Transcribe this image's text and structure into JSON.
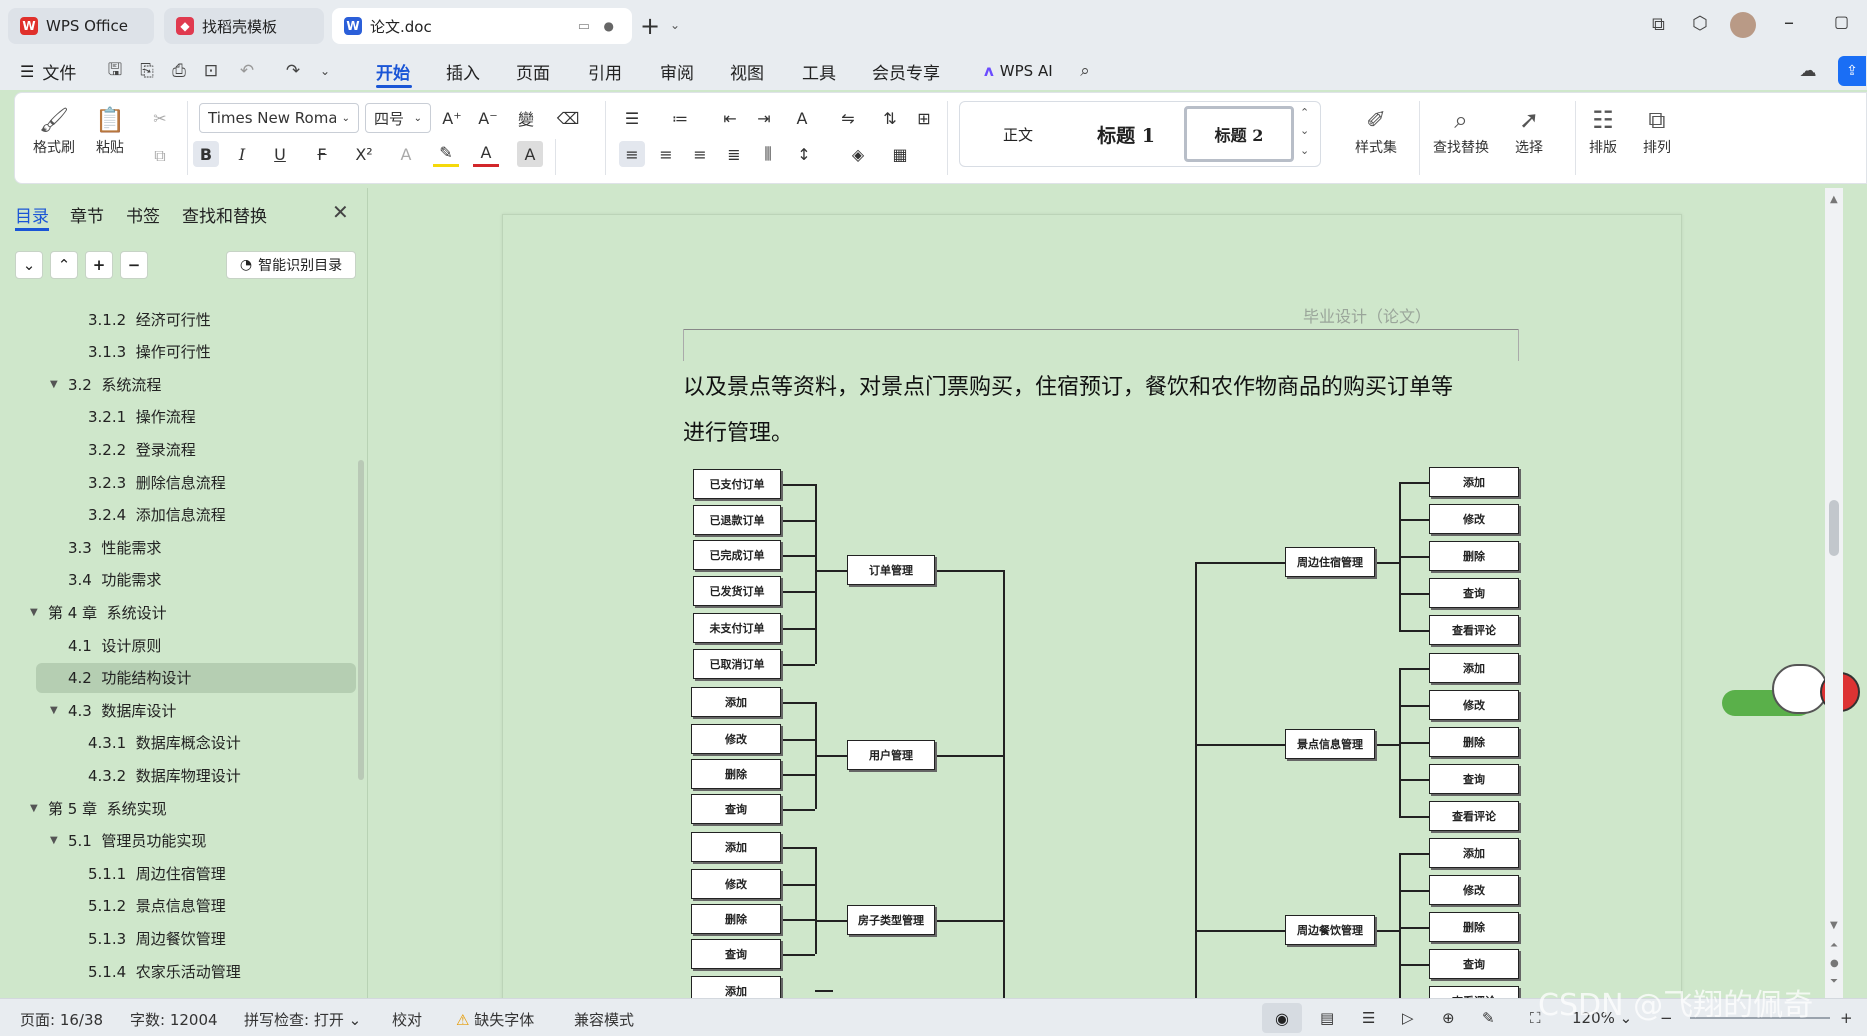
{
  "tabs": [
    {
      "label": "WPS Office",
      "icon": "wps-logo-icon",
      "color": "#e0302b"
    },
    {
      "label": "找稻壳模板",
      "icon": "daoke-logo-icon",
      "color": "#e03a4f"
    },
    {
      "label": "论文.doc",
      "icon": "word-doc-icon",
      "color": "#2b5fd9"
    }
  ],
  "menu": {
    "file": "文件",
    "items": [
      "开始",
      "插入",
      "页面",
      "引用",
      "审阅",
      "视图",
      "工具",
      "会员专享"
    ],
    "active": "开始",
    "wps_ai": "WPS AI"
  },
  "ribbon": {
    "format_painter": "格式刷",
    "paste": "粘贴",
    "font_name": "Times New Roman",
    "font_size": "四号",
    "styles": {
      "normal": "正文",
      "h1": "标题 1",
      "h2": "标题 2"
    },
    "style_set": "样式集",
    "find_replace": "查找替换",
    "select": "选择",
    "layout": "排版",
    "arrange": "排列"
  },
  "sidebar": {
    "tabs": [
      "目录",
      "章节",
      "书签",
      "查找和替换"
    ],
    "active_tab": "目录",
    "smart_toc": "智能识别目录",
    "items": [
      {
        "label": "3.1.2  经济可行性",
        "level": 3,
        "caret": ""
      },
      {
        "label": "3.1.3  操作可行性",
        "level": 3,
        "caret": ""
      },
      {
        "label": "3.2  系统流程",
        "level": 2,
        "caret": "▼"
      },
      {
        "label": "3.2.1  操作流程",
        "level": 3,
        "caret": ""
      },
      {
        "label": "3.2.2  登录流程",
        "level": 3,
        "caret": ""
      },
      {
        "label": "3.2.3  删除信息流程",
        "level": 3,
        "caret": ""
      },
      {
        "label": "3.2.4  添加信息流程",
        "level": 3,
        "caret": ""
      },
      {
        "label": "3.3  性能需求",
        "level": 2,
        "caret": ""
      },
      {
        "label": "3.4  功能需求",
        "level": 2,
        "caret": ""
      },
      {
        "label": "第 4 章  系统设计",
        "level": 1,
        "caret": "▼"
      },
      {
        "label": "4.1  设计原则",
        "level": 2,
        "caret": ""
      },
      {
        "label": "4.2  功能结构设计",
        "level": 2,
        "caret": "",
        "selected": true
      },
      {
        "label": "4.3  数据库设计",
        "level": 2,
        "caret": "▼"
      },
      {
        "label": "4.3.1  数据库概念设计",
        "level": 3,
        "caret": ""
      },
      {
        "label": "4.3.2  数据库物理设计",
        "level": 3,
        "caret": ""
      },
      {
        "label": "第 5 章  系统实现",
        "level": 1,
        "caret": "▼"
      },
      {
        "label": "5.1  管理员功能实现",
        "level": 2,
        "caret": "▼"
      },
      {
        "label": "5.1.1  周边住宿管理",
        "level": 3,
        "caret": ""
      },
      {
        "label": "5.1.2  景点信息管理",
        "level": 3,
        "caret": ""
      },
      {
        "label": "5.1.3  周边餐饮管理",
        "level": 3,
        "caret": ""
      },
      {
        "label": "5.1.4  农家乐活动管理",
        "level": 3,
        "caret": ""
      }
    ]
  },
  "document": {
    "header": "毕业设计（论文）",
    "line1": "以及景点等资料，对景点门票购买，住宿预订，餐饮和农作物商品的购买订单等",
    "line2": "进行管理。",
    "diagram": {
      "left_leaves": [
        "已支付订单",
        "已退款订单",
        "已完成订单",
        "已发货订单",
        "未支付订单",
        "已取消订单",
        "添加",
        "修改",
        "删除",
        "查询",
        "添加",
        "修改",
        "删除",
        "查询",
        "添加"
      ],
      "left_parents": [
        "订单管理",
        "用户管理",
        "房子类型管理"
      ],
      "right_parents": [
        "周边住宿管理",
        "景点信息管理",
        "周边餐饮管理"
      ],
      "right_leaves": [
        "添加",
        "修改",
        "删除",
        "查询",
        "查看评论",
        "添加",
        "修改",
        "删除",
        "查询",
        "查看评论",
        "添加",
        "修改",
        "删除",
        "查询",
        "查看评论"
      ]
    }
  },
  "status": {
    "page": "页面: 16/38",
    "words": "字数: 12004",
    "spell": "拼写检查: 打开",
    "proof": "校对",
    "missing_font": "缺失字体",
    "compat": "兼容模式",
    "zoom": "120%"
  },
  "watermark": "CSDN @飞翔的佩奇"
}
